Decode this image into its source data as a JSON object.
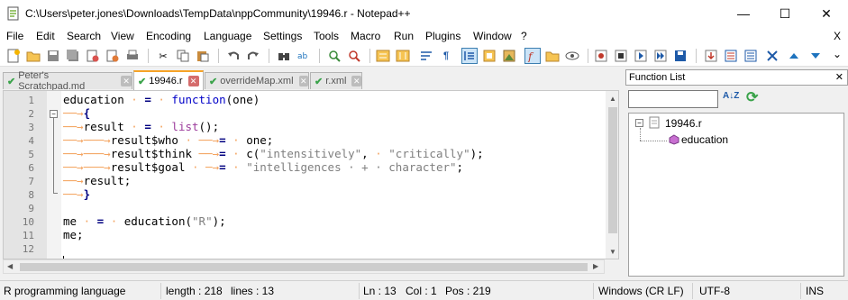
{
  "window": {
    "title": "C:\\Users\\peter.jones\\Downloads\\TempData\\nppCommunity\\19946.r - Notepad++",
    "minimize": "—",
    "maximize": "☐",
    "close": "✕"
  },
  "menu": {
    "items": [
      "File",
      "Edit",
      "Search",
      "View",
      "Encoding",
      "Language",
      "Settings",
      "Tools",
      "Macro",
      "Run",
      "Plugins",
      "Window",
      "?"
    ],
    "close_doc": "X"
  },
  "tabs": [
    {
      "label": "Peter's Scratchpad.md",
      "active": false
    },
    {
      "label": "19946.r",
      "active": true
    },
    {
      "label": "overrideMap.xml",
      "active": false
    },
    {
      "label": "r.xml",
      "active": false
    }
  ],
  "editor": {
    "line_numbers": [
      "1",
      "2",
      "3",
      "4",
      "5",
      "6",
      "7",
      "8",
      "9",
      "10",
      "11",
      "12"
    ]
  },
  "function_list": {
    "title": "Function List",
    "close": "✕",
    "file_node": "19946.r",
    "function_node": "education",
    "expander": "−",
    "sort_icon": "A↓Z",
    "reload_icon": "⟳"
  },
  "status": {
    "language": "R programming language",
    "length": "length : 218",
    "lines": "lines : 13",
    "ln": "Ln : 13",
    "col": "Col : 1",
    "pos": "Pos : 219",
    "eol": "Windows (CR LF)",
    "encoding": "UTF-8",
    "mode": "INS"
  },
  "colors": {
    "accent_tab": "#f6a327",
    "keyword": "#0000c8",
    "string": "#7f7f7f",
    "tab_arrow": "#f4a460"
  }
}
